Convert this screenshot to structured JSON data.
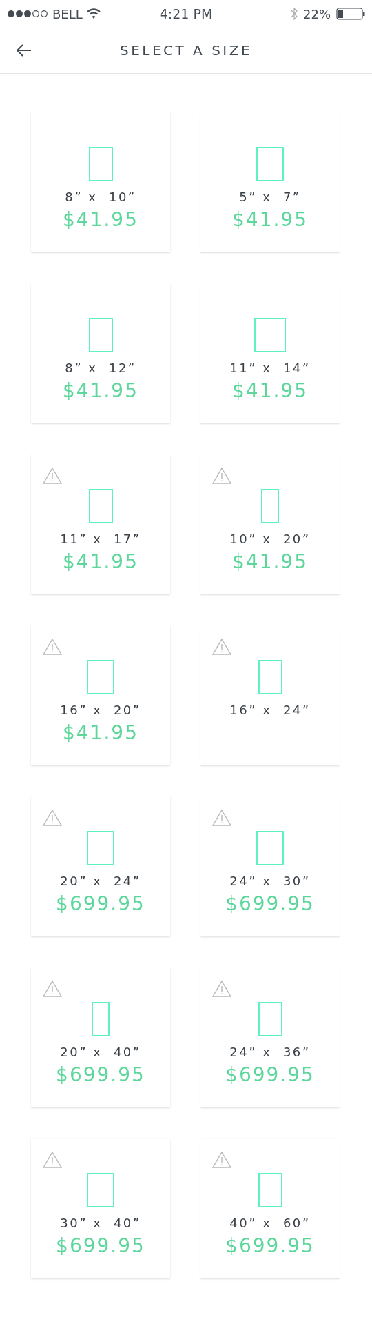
{
  "status_bar": {
    "carrier": "BELL",
    "time": "4:21 PM",
    "battery": "22%"
  },
  "header": {
    "title": "SELECT A SIZE"
  },
  "sizes": [
    {
      "size": "8” x  10”",
      "price": "$41.95",
      "warning": false,
      "kind": "standard"
    },
    {
      "size": "5” x  7”",
      "price": "$41.95",
      "warning": false,
      "kind": "wide"
    },
    {
      "size": "8” x  12”",
      "price": "$41.95",
      "warning": false,
      "kind": "standard"
    },
    {
      "size": "11” x  14”",
      "price": "$41.95",
      "warning": false,
      "kind": "square"
    },
    {
      "size": "11” x  17”",
      "price": "$41.95",
      "warning": true,
      "kind": "standard"
    },
    {
      "size": "10” x  20”",
      "price": "$41.95",
      "warning": true,
      "kind": "narrow"
    },
    {
      "size": "16” x  20”",
      "price": "$41.95",
      "warning": true,
      "kind": "wide"
    },
    {
      "size": "16” x  24”",
      "warning": true,
      "kind": "standard"
    },
    {
      "size": "20” x  24”",
      "price": "$699.95",
      "warning": true,
      "kind": "wide"
    },
    {
      "size": "24” x  30”",
      "price": "$699.95",
      "warning": true,
      "kind": "wide"
    },
    {
      "size": "20” x  40”",
      "price": "$699.95",
      "warning": true,
      "kind": "narrow"
    },
    {
      "size": "24” x  36”",
      "price": "$699.95",
      "warning": true,
      "kind": "standard"
    },
    {
      "size": "30” x  40”",
      "price": "$699.95",
      "warning": true,
      "kind": "wide"
    },
    {
      "size": "40” x  60”",
      "price": "$699.95",
      "warning": true,
      "kind": "standard"
    }
  ]
}
